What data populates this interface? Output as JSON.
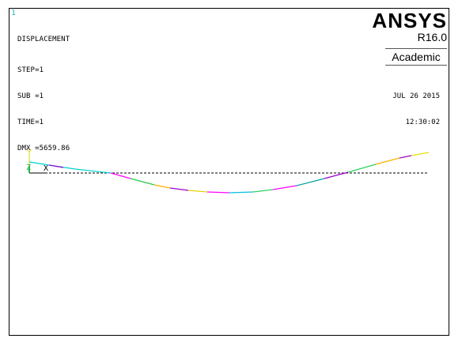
{
  "window": {
    "index": "1"
  },
  "result_info": {
    "title": "DISPLACEMENT",
    "step": "STEP=1",
    "sub": "SUB =1",
    "time": "TIME=1",
    "dmx": "DMX =5659.86"
  },
  "brand": {
    "name": "ANSYS",
    "version": "R16.0",
    "edition": "Academic"
  },
  "timestamp": {
    "date": "JUL 26 2015",
    "time": "12:30:02"
  },
  "triad": {
    "x_label": "X",
    "y_label": "Y",
    "z_label": "Z"
  },
  "colors": {
    "background": "#ffffff",
    "undeformed_line": "#000000",
    "window_index": "#2fb7b7",
    "triad_x": "#000000",
    "triad_y": "#d9d900",
    "triad_z": "#2ab24a",
    "deformed_segments": [
      "#00d0d0",
      "#9a00d0",
      "#00b8c8",
      "#26c94a",
      "#e0d000",
      "#ff00ff",
      "#ffb000",
      "#00a0a0",
      "#00c0e0",
      "#a000c0",
      "#30d060",
      "#e8e000"
    ]
  }
}
